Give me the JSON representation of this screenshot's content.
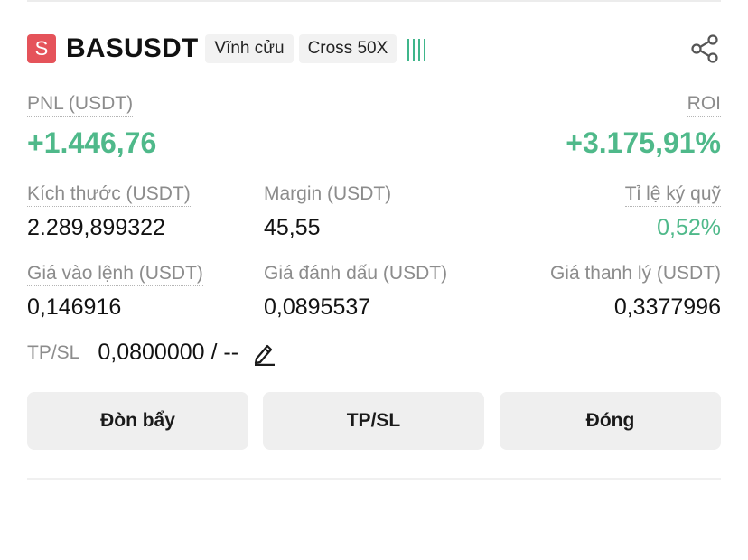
{
  "position": {
    "side_badge": "S",
    "symbol": "BASUSDT",
    "tags": [
      "Vĩnh cửu",
      "Cross 50X"
    ],
    "icons": {
      "share": "share-icon",
      "edit": "edit-icon",
      "strength": "strength-bars-icon"
    }
  },
  "pnl": {
    "label": "PNL (USDT)",
    "value": "+1.446,76"
  },
  "roi": {
    "label": "ROI",
    "value": "+3.175,91%"
  },
  "stats_row1": [
    {
      "label": "Kích thước (USDT)",
      "value": "2.289,899322"
    },
    {
      "label": "Margin (USDT)",
      "value": "45,55"
    },
    {
      "label": "Tỉ lệ ký quỹ",
      "value": "0,52%"
    }
  ],
  "stats_row2": [
    {
      "label": "Giá vào lệnh (USDT)",
      "value": "0,146916"
    },
    {
      "label": "Giá đánh dấu (USDT)",
      "value": "0,0895537"
    },
    {
      "label": "Giá thanh lý (USDT)",
      "value": "0,3377996"
    }
  ],
  "tpsl": {
    "label": "TP/SL",
    "value": "0,0800000 / --"
  },
  "buttons": {
    "leverage": "Đòn bẩy",
    "tpsl": "TP/SL",
    "close": "Đóng"
  },
  "colors": {
    "green": "#4fb98a",
    "short_badge": "#e5535a"
  }
}
